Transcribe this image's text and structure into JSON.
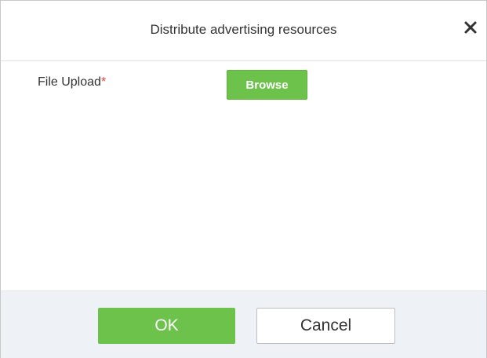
{
  "dialog": {
    "title": "Distribute advertising resources",
    "close_icon": "close-icon"
  },
  "form": {
    "file_upload_label": "File Upload",
    "required_marker": "*",
    "browse_label": "Browse"
  },
  "footer": {
    "ok_label": "OK",
    "cancel_label": "Cancel"
  },
  "colors": {
    "accent_green": "#6cc24a",
    "required_red": "#e2453c",
    "footer_bg": "#eef1f5"
  }
}
